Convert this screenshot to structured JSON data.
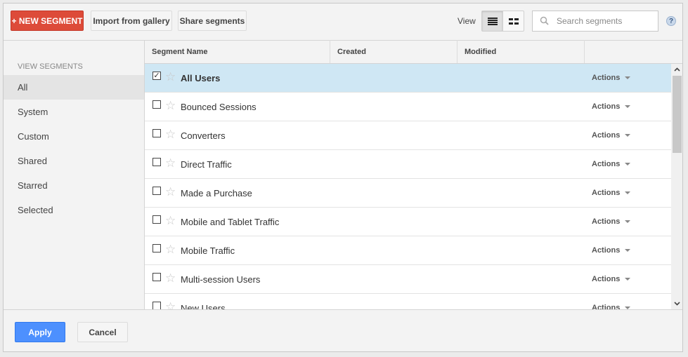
{
  "toolbar": {
    "new_segment_label": "+ NEW SEGMENT",
    "import_label": "Import from gallery",
    "share_label": "Share segments",
    "view_label": "View",
    "view_modes": [
      {
        "name": "list-view",
        "icon": "list-icon",
        "active": true
      },
      {
        "name": "grid-view",
        "icon": "grid-icon",
        "active": false
      }
    ],
    "search_placeholder": "Search segments",
    "search_value": "",
    "help_icon": "?"
  },
  "sidebar": {
    "heading": "VIEW SEGMENTS",
    "items": [
      {
        "label": "All",
        "active": true
      },
      {
        "label": "System",
        "active": false
      },
      {
        "label": "Custom",
        "active": false
      },
      {
        "label": "Shared",
        "active": false
      },
      {
        "label": "Starred",
        "active": false
      },
      {
        "label": "Selected",
        "active": false
      }
    ]
  },
  "table": {
    "columns": [
      "Segment Name",
      "Created",
      "Modified",
      ""
    ],
    "action_label": "Actions",
    "rows": [
      {
        "name": "All Users",
        "checked": true,
        "starred": false,
        "created": "",
        "modified": ""
      },
      {
        "name": "Bounced Sessions",
        "checked": false,
        "starred": false,
        "created": "",
        "modified": ""
      },
      {
        "name": "Converters",
        "checked": false,
        "starred": false,
        "created": "",
        "modified": ""
      },
      {
        "name": "Direct Traffic",
        "checked": false,
        "starred": false,
        "created": "",
        "modified": ""
      },
      {
        "name": "Made a Purchase",
        "checked": false,
        "starred": false,
        "created": "",
        "modified": ""
      },
      {
        "name": "Mobile and Tablet Traffic",
        "checked": false,
        "starred": false,
        "created": "",
        "modified": ""
      },
      {
        "name": "Mobile Traffic",
        "checked": false,
        "starred": false,
        "created": "",
        "modified": ""
      },
      {
        "name": "Multi-session Users",
        "checked": false,
        "starred": false,
        "created": "",
        "modified": ""
      },
      {
        "name": "New Users",
        "checked": false,
        "starred": false,
        "created": "",
        "modified": ""
      }
    ]
  },
  "footer": {
    "apply_label": "Apply",
    "cancel_label": "Cancel"
  },
  "colors": {
    "new_segment_bg": "#dd4b39",
    "apply_bg": "#4d90fe",
    "selected_row_bg": "#cfe7f4"
  }
}
